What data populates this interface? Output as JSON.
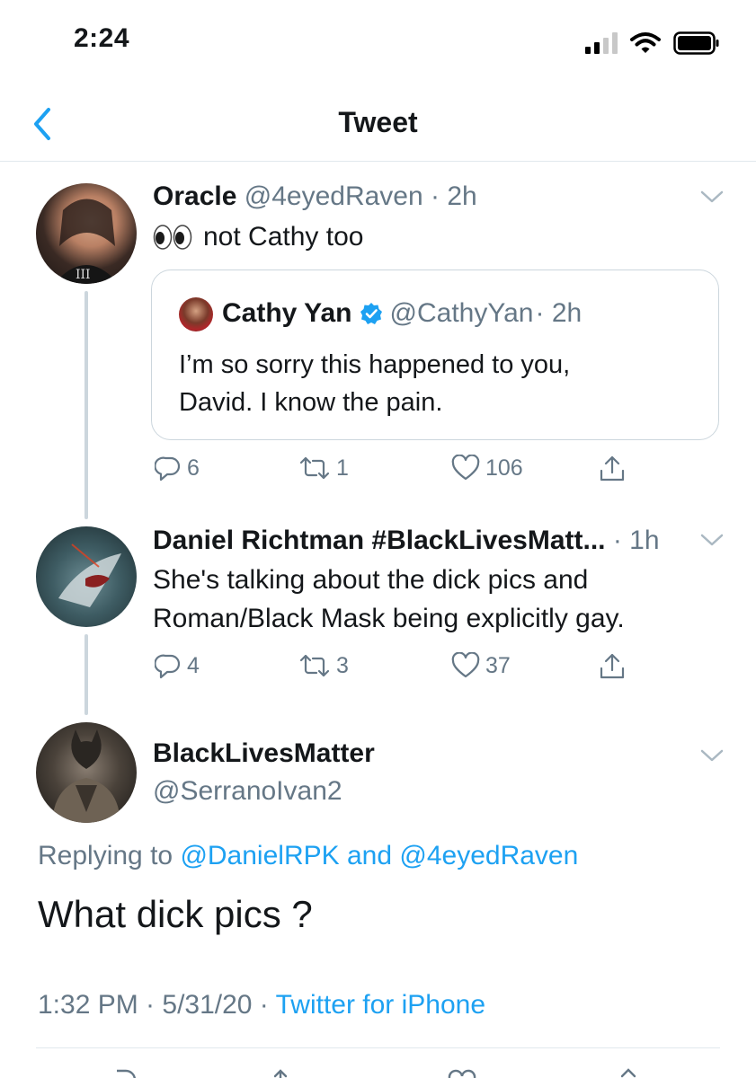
{
  "status_bar": {
    "time": "2:24"
  },
  "nav": {
    "title": "Tweet"
  },
  "tweet1": {
    "name": "Oracle",
    "handle": "@4eyedRaven",
    "time": "· 2h",
    "text": "not Cathy too",
    "quote": {
      "name": "Cathy Yan",
      "handle": "@CathyYan",
      "time": "· 2h",
      "text_line1": "I’m so sorry this happened to you,",
      "text_line2": "David. I know the pain."
    },
    "replies": "6",
    "retweets": "1",
    "likes": "106"
  },
  "tweet2": {
    "name": "Daniel Richtman #BlackLivesMatt...",
    "time": "· 1h",
    "text_line1": "She's talking about the dick pics and",
    "text_line2": "Roman/Black Mask being explicitly gay.",
    "replies": "4",
    "retweets": "3",
    "likes": "37"
  },
  "main_tweet": {
    "name": "BlackLivesMatter",
    "handle": "@SerranoIvan2",
    "replying_prefix": "Replying to",
    "replying_user1": "@DanielRPK",
    "replying_and": "and",
    "replying_user2": "@4eyedRaven",
    "text": "What dick pics ?",
    "timestamp": "1:32 PM · 5/31/20 ·",
    "source": "Twitter for iPhone"
  },
  "colors": {
    "accent": "#1da1f2",
    "secondary_text": "#657786",
    "verified": "#1da1f2"
  },
  "icons": [
    "back-chevron-icon",
    "signal-icon",
    "wifi-icon",
    "battery-icon",
    "eyes-emoji-icon",
    "verified-badge-icon",
    "reply-icon",
    "retweet-icon",
    "like-icon",
    "share-icon",
    "chevron-down-icon"
  ]
}
